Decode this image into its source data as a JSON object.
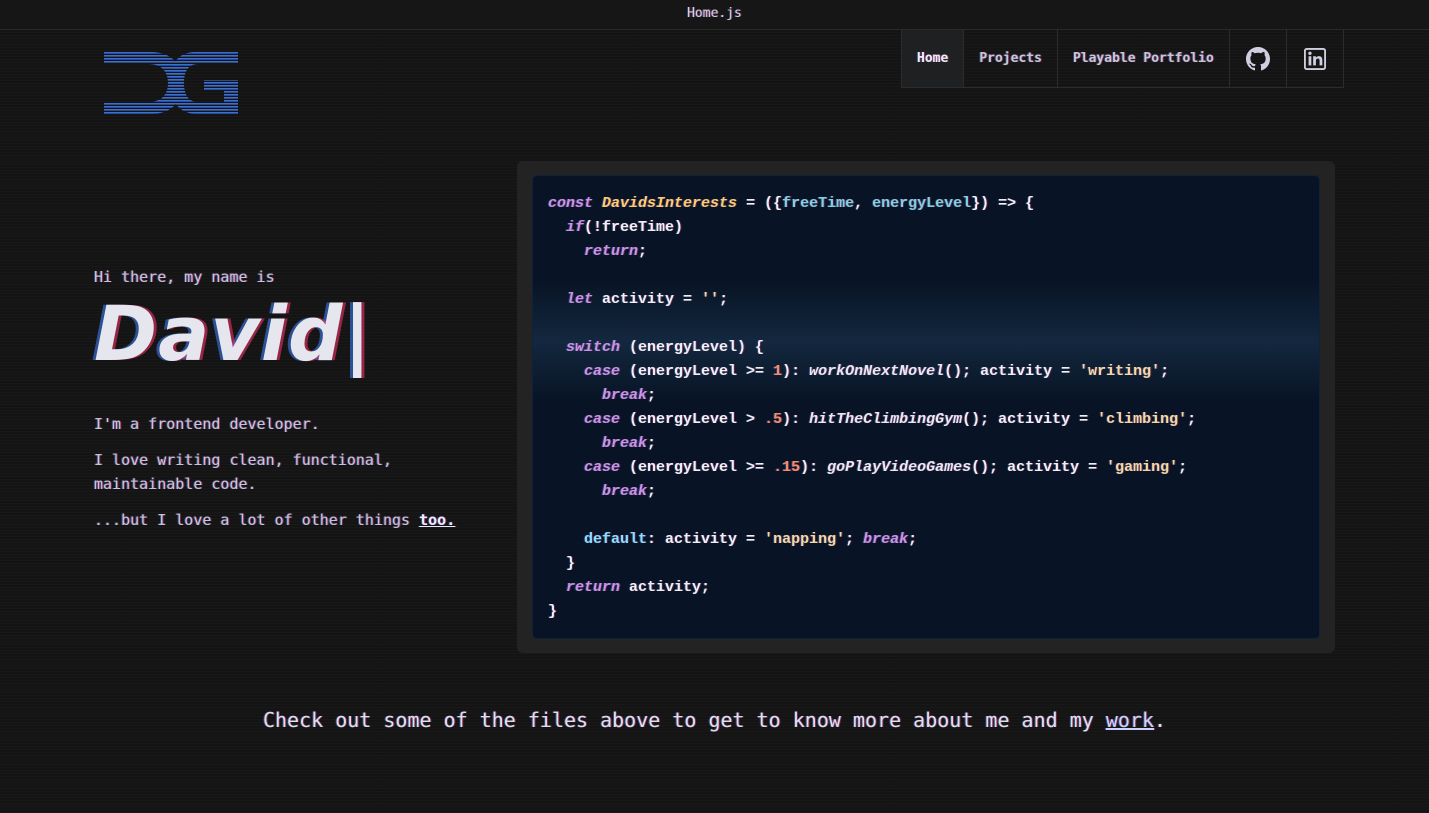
{
  "window": {
    "title": "Home.js"
  },
  "nav": {
    "items": [
      {
        "label": "Home",
        "active": true
      },
      {
        "label": "Projects",
        "active": false
      },
      {
        "label": "Playable Portfolio",
        "active": false
      }
    ],
    "icons": [
      "github-icon",
      "linkedin-icon"
    ]
  },
  "logo": {
    "icon": "dg-logo-icon",
    "color": "#2f63c8"
  },
  "intro": {
    "greeting": "Hi there, my name is",
    "name": "David|",
    "lines": [
      "I'm a frontend developer.",
      "I love writing clean, functional,",
      "maintainable code.",
      "...but I love a lot of other things"
    ],
    "link_text": "too."
  },
  "code": {
    "language": "javascript",
    "lines": [
      "const DavidsInterests = ({freeTime, energyLevel}) => {",
      "  if(!freeTime)",
      "    return;",
      "",
      "  let activity = '';",
      "",
      "  switch (energyLevel) {",
      "    case (energyLevel >= 1): workOnNextNovel(); activity = 'writing';",
      "      break;",
      "    case (energyLevel > .5): hitTheClimbingGym(); activity = 'climbing';",
      "      break;",
      "    case (energyLevel >= .15): goPlayVideoGames(); activity = 'gaming';",
      "      break;",
      "",
      "    default: activity = 'napping'; break;",
      "  }",
      "  return activity;",
      "}"
    ]
  },
  "footer": {
    "text_before": "Check out some of the files above to get to know more about me and my ",
    "link_text": "work",
    "text_after": "."
  },
  "colors": {
    "background": "#141414",
    "code_background": "#081425",
    "keyword": "#c792ea",
    "function": "#ffcb6b",
    "string": "#f3d9a0",
    "number": "#f78c6c"
  }
}
